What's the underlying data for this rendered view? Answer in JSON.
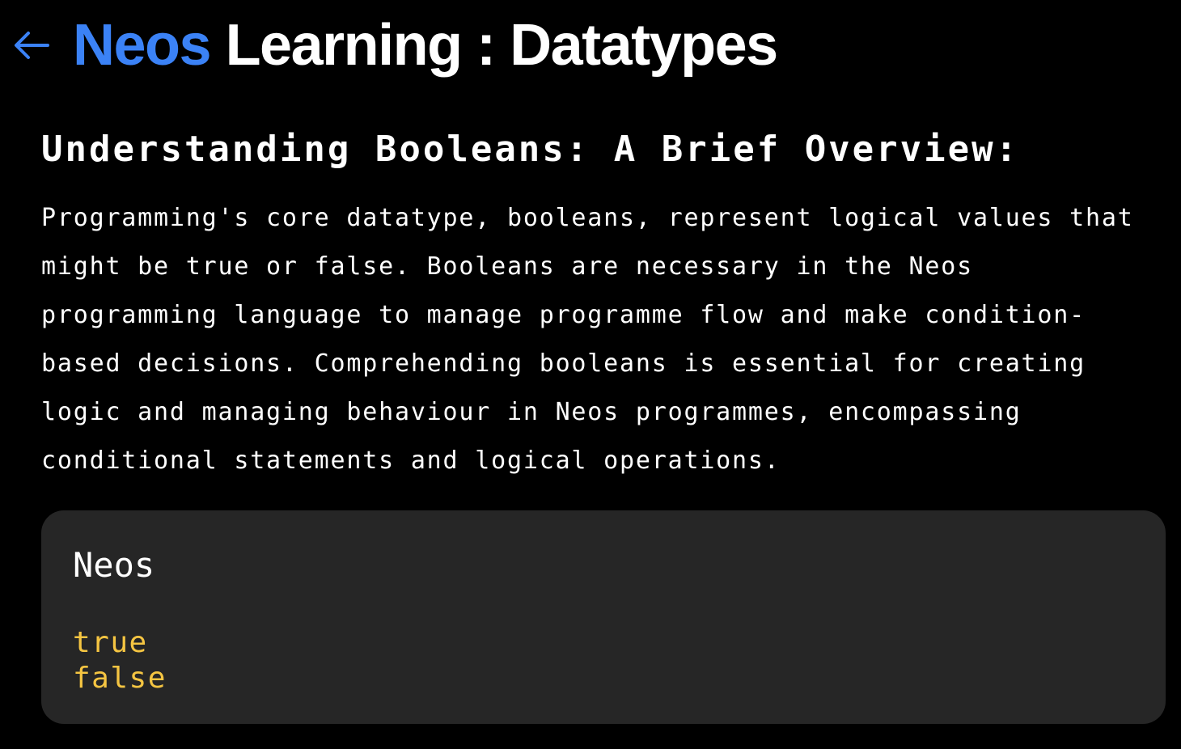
{
  "header": {
    "back_icon": "arrow-left-icon",
    "title_brand": "Neos",
    "title_rest": " Learning : Datatypes",
    "brand_color": "#3b82f6"
  },
  "section": {
    "heading": "Understanding Booleans: A Brief Overview:",
    "body": "Programming's core datatype, booleans, represent logical values that might be true or false. Booleans are necessary in the Neos programming language to manage programme flow and make condition-based decisions. Comprehending booleans is essential for creating logic and managing behaviour in Neos programmes, encompassing conditional statements and logical operations."
  },
  "code_block": {
    "language": "Neos",
    "lines": [
      "true",
      "false"
    ],
    "keyword_color": "#f5c542",
    "background": "#262626"
  }
}
